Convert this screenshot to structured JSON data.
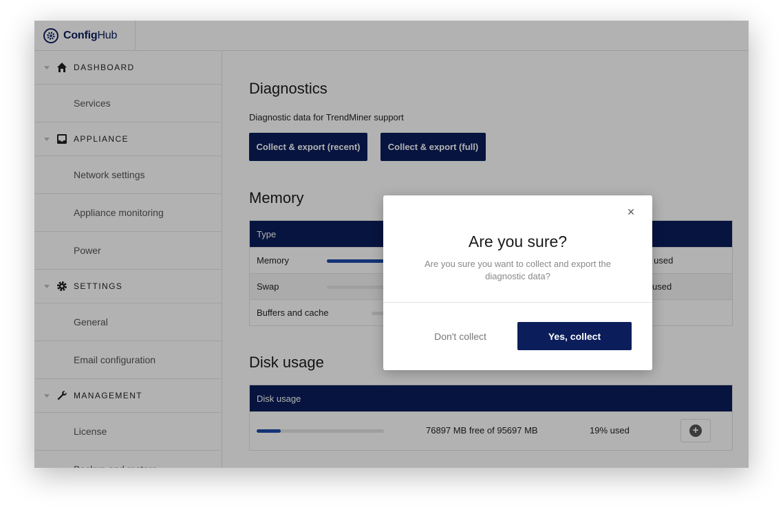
{
  "app": {
    "logo_config": "Config",
    "logo_hub": "Hub"
  },
  "sidebar": {
    "sections": [
      {
        "label": "DASHBOARD",
        "icon": "home-icon",
        "items": [
          "Services"
        ]
      },
      {
        "label": "APPLIANCE",
        "icon": "inbox-icon",
        "items": [
          "Network settings",
          "Appliance monitoring",
          "Power"
        ]
      },
      {
        "label": "SETTINGS",
        "icon": "gear-icon",
        "items": [
          "General",
          "Email configuration"
        ]
      },
      {
        "label": "MANAGEMENT",
        "icon": "wrench-icon",
        "items": [
          "License",
          "Backup and restore"
        ]
      }
    ]
  },
  "diagnostics": {
    "title": "Diagnostics",
    "description": "Diagnostic data for TrendMiner support",
    "btn_recent": "Collect & export (recent)",
    "btn_full": "Collect & export (full)"
  },
  "memory": {
    "title": "Memory",
    "header_type": "Type",
    "rows": [
      {
        "label": "Memory",
        "used_text": "% used",
        "fill": 0.45
      },
      {
        "label": "Swap",
        "used_text": "used",
        "fill": 0.0
      },
      {
        "label": "Buffers and cache",
        "used_text": "",
        "fill": 0.0
      }
    ]
  },
  "disk": {
    "title": "Disk usage",
    "header": "Disk usage",
    "row": {
      "free_text": "76897 MB free of 95697 MB",
      "used_text": "19% used",
      "fill": 0.19
    }
  },
  "modal": {
    "title": "Are you sure?",
    "text": "Are you sure you want to collect and export the diagnostic data?",
    "cancel": "Don't collect",
    "confirm": "Yes, collect",
    "close": "×"
  },
  "colors": {
    "navy": "#0b1e5b",
    "bar_fill": "#1e4aa8"
  }
}
